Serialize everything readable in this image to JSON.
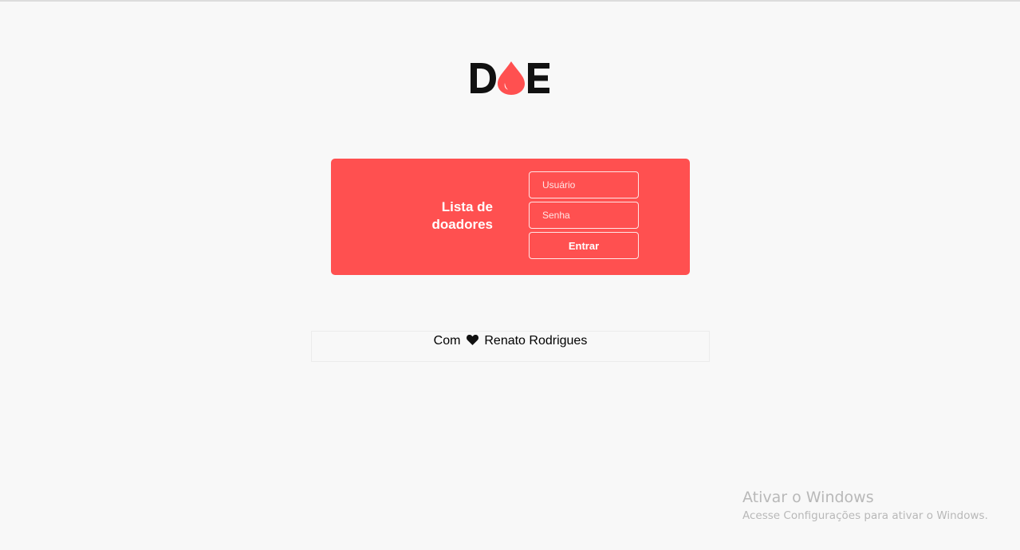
{
  "brand": {
    "logo_text": "DOE",
    "drop_color": "#ff5050"
  },
  "login_panel": {
    "title_line1": "Lista de",
    "title_line2": "doadores",
    "username_placeholder": "Usuário",
    "password_placeholder": "Senha",
    "submit_label": "Entrar",
    "background_color": "#ff5050"
  },
  "footer": {
    "prefix": "Com",
    "icon": "heart-icon",
    "author": "Renato Rodrigues"
  },
  "windows_watermark": {
    "title": "Ativar o Windows",
    "subtitle": "Acesse Configurações para ativar o Windows."
  }
}
